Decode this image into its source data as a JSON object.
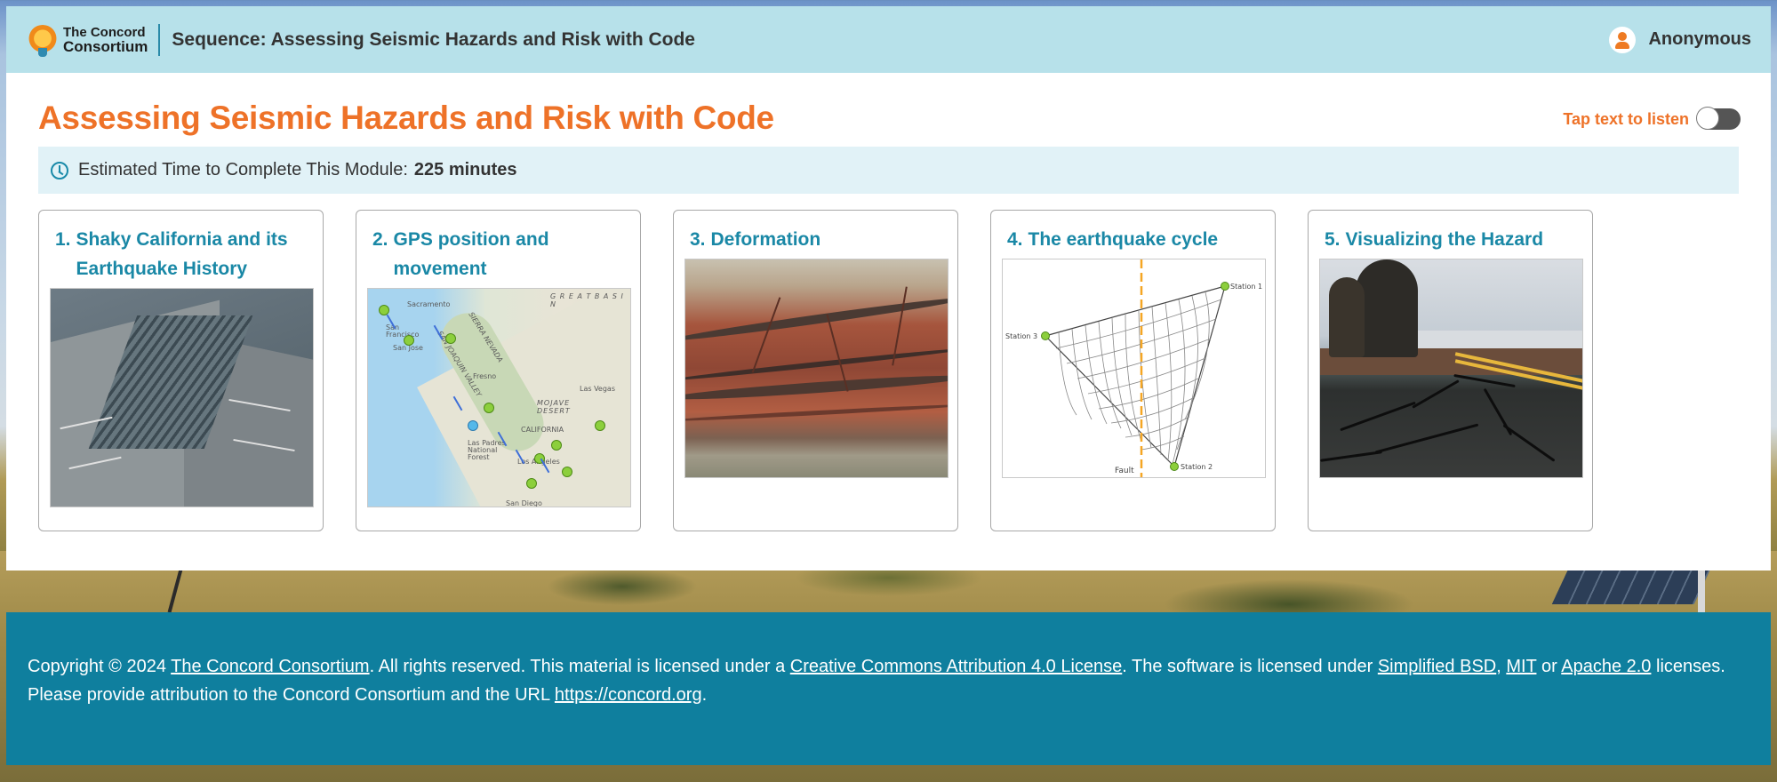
{
  "header": {
    "logo_line1": "The Concord",
    "logo_line2": "Consortium",
    "sequence_title": "Sequence: Assessing Seismic Hazards and Risk with Code",
    "user_name": "Anonymous"
  },
  "main": {
    "title": "Assessing Seismic Hazards and Risk with Code",
    "tts_label": "Tap text to listen",
    "tts_enabled": false,
    "time_label": "Estimated Time to Complete This Module:",
    "time_value": "225 minutes"
  },
  "activities": [
    {
      "number": "1.",
      "title": "Shaky California and its Earthquake History",
      "image": "collapsed-bridge-photo"
    },
    {
      "number": "2.",
      "title": "GPS position and movement",
      "image": "california-gps-map"
    },
    {
      "number": "3.",
      "title": "Deformation",
      "image": "folded-rock-layers-photo"
    },
    {
      "number": "4.",
      "title": "The earthquake cycle",
      "image": "fault-deformation-diagram"
    },
    {
      "number": "5.",
      "title": "Visualizing the Hazard",
      "image": "cracked-road-photo"
    }
  ],
  "map_labels": {
    "great_basin": "G R E A T   B A S I N",
    "sacramento": "Sacramento",
    "san_francisco": "San Francisco",
    "san_jose": "San Jose",
    "fresno": "Fresno",
    "sierra": "SIERRA NEVADA",
    "joaquin": "SAN JOAQUIN VALLEY",
    "mojave": "MOJAVE DESERT",
    "las_vegas": "Las Vegas",
    "california": "CALIFORNIA",
    "las_padres": "Las Padres National Forest",
    "los_angeles": "Los Angeles",
    "san_diego": "San Diego"
  },
  "diagram_labels": {
    "station1": "Station 1",
    "station2": "Station 2",
    "station3": "Station 3",
    "fault": "Fault"
  },
  "footer": {
    "p1": "Copyright © 2024 ",
    "link_cc": "The Concord Consortium",
    "p2": ". All rights reserved. This material is licensed under a ",
    "link_license": "Creative Commons Attribution 4.0 License",
    "p3": ". The software is licensed under ",
    "link_bsd": "Simplified BSD",
    "p4": ", ",
    "link_mit": "MIT",
    "p5": " or ",
    "link_apache": "Apache 2.0",
    "p6": " licenses.",
    "p7": "Please provide attribution to the Concord Consortium and the URL ",
    "link_url": "https://concord.org",
    "p8": "."
  },
  "colors": {
    "header_bg": "#b7e1ea",
    "title_orange": "#ee7228",
    "card_title_teal": "#1a88a6",
    "footer_bg": "#0f7f9e"
  }
}
